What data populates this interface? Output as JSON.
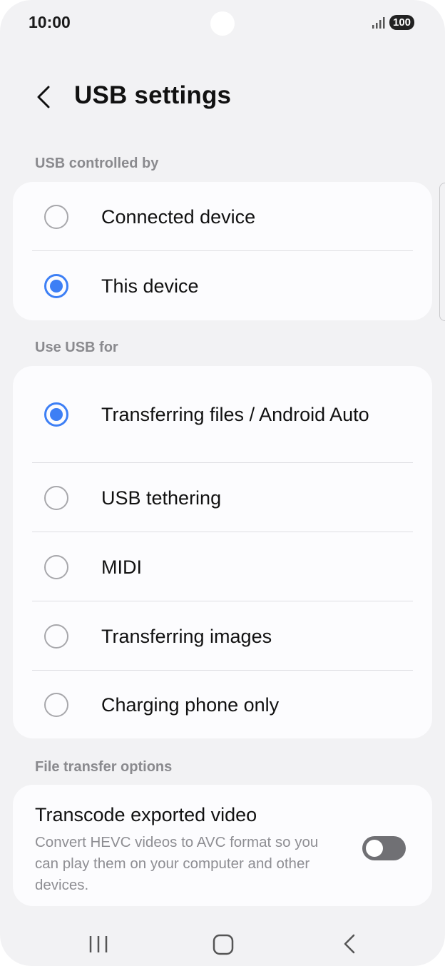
{
  "status_bar": {
    "time": "10:00",
    "battery": "100",
    "icons": [
      "camera-cutout",
      "signal-icon",
      "battery-icon"
    ]
  },
  "header": {
    "title": "USB settings",
    "back_icon": "chevron-left-icon"
  },
  "controlled_by": {
    "label": "USB controlled by",
    "options": [
      {
        "label": "Connected device",
        "selected": false
      },
      {
        "label": "This device",
        "selected": true
      }
    ]
  },
  "use_usb_for": {
    "label": "Use USB for",
    "options": [
      {
        "label": "Transferring files / Android Auto",
        "selected": true
      },
      {
        "label": "USB tethering",
        "selected": false
      },
      {
        "label": "MIDI",
        "selected": false
      },
      {
        "label": "Transferring images",
        "selected": false
      },
      {
        "label": "Charging phone only",
        "selected": false
      }
    ]
  },
  "file_transfer": {
    "label": "File transfer options",
    "transcode": {
      "title": "Transcode exported video",
      "description": "Convert HEVC videos to AVC format so you can play them on your computer and other devices.",
      "enabled": false
    }
  },
  "nav": {
    "icons": [
      "recents-icon",
      "home-icon",
      "back-icon"
    ]
  },
  "colors": {
    "accent": "#3d7ff5",
    "background": "#f2f2f4",
    "card": "#fcfcfe",
    "muted_text": "#8a8a8e",
    "toggle_off": "#707074"
  }
}
